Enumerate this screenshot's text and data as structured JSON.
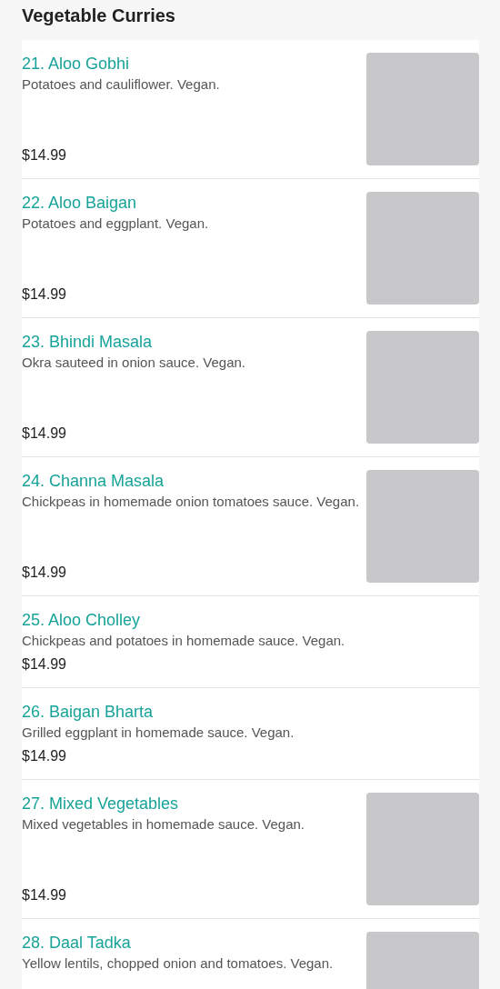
{
  "section_title": "Vegetable Curries",
  "items": [
    {
      "name": "21. Aloo Gobhi",
      "description": "Potatoes and cauliflower. Vegan.",
      "price": "$14.99",
      "has_image": true
    },
    {
      "name": "22. Aloo Baigan",
      "description": "Potatoes and eggplant. Vegan.",
      "price": "$14.99",
      "has_image": true
    },
    {
      "name": "23. Bhindi Masala",
      "description": "Okra sauteed in onion sauce. Vegan.",
      "price": "$14.99",
      "has_image": true
    },
    {
      "name": "24. Channa Masala",
      "description": "Chickpeas in homemade onion tomatoes sauce. Vegan.",
      "price": "$14.99",
      "has_image": true
    },
    {
      "name": "25. Aloo Cholley",
      "description": "Chickpeas and potatoes in homemade sauce. Vegan.",
      "price": "$14.99",
      "has_image": false
    },
    {
      "name": "26. Baigan Bharta",
      "description": "Grilled eggplant in homemade sauce. Vegan.",
      "price": "$14.99",
      "has_image": false
    },
    {
      "name": "27. Mixed Vegetables",
      "description": "Mixed vegetables in homemade sauce. Vegan.",
      "price": "$14.99",
      "has_image": true
    },
    {
      "name": "28. Daal Tadka",
      "description": "Yellow lentils, chopped onion and tomatoes. Vegan.",
      "has_image": true
    }
  ]
}
